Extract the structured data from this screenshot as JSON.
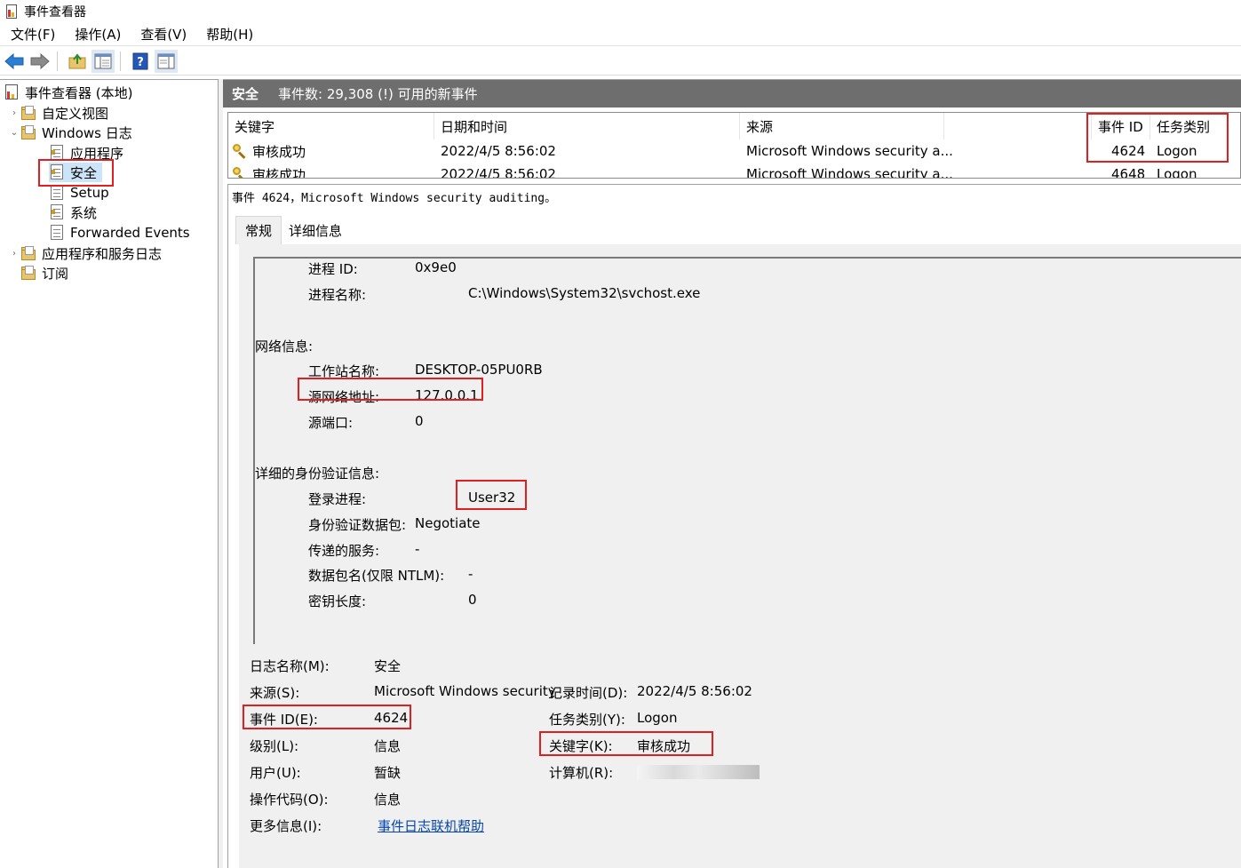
{
  "window": {
    "title": "事件查看器"
  },
  "menu": [
    {
      "label": "文件(F)"
    },
    {
      "label": "操作(A)"
    },
    {
      "label": "查看(V)"
    },
    {
      "label": "帮助(H)"
    }
  ],
  "toolbar": {
    "icons": [
      "back-arrow-icon",
      "forward-arrow-icon",
      "folder-up-icon",
      "show-hide-tree-icon",
      "help-icon",
      "properties-icon"
    ]
  },
  "tree": {
    "root": "事件查看器 (本地)",
    "custom_views": "自定义视图",
    "windows_logs": "Windows 日志",
    "application": "应用程序",
    "security": "安全",
    "setup": "Setup",
    "system": "系统",
    "forwarded": "Forwarded Events",
    "app_service_logs": "应用程序和服务日志",
    "subscriptions": "订阅"
  },
  "header": {
    "name": "安全",
    "count_text": "事件数: 29,308 (!) 可用的新事件"
  },
  "grid": {
    "columns": {
      "keyword": "关键字",
      "datetime": "日期和时间",
      "source": "来源",
      "event_id": "事件 ID",
      "task": "任务类别"
    },
    "rows": [
      {
        "keyword": "审核成功",
        "datetime": "2022/4/5 8:56:02",
        "source": "Microsoft Windows security a...",
        "event_id": "4624",
        "task": "Logon"
      },
      {
        "keyword": "审核成功",
        "datetime": "2022/4/5 8:56:02",
        "source": "Microsoft Windows security a...",
        "event_id": "4648",
        "task": "Logon"
      }
    ]
  },
  "detail": {
    "title": "事件 4624，Microsoft Windows security auditing。",
    "tabs": {
      "general": "常规",
      "details": "详细信息"
    },
    "message": {
      "process_id_label": "进程 ID:",
      "process_id_value": "0x9e0",
      "process_name_label": "进程名称:",
      "process_name_value": "C:\\Windows\\System32\\svchost.exe",
      "network_header": "网络信息:",
      "workstation_label": "工作站名称:",
      "workstation_value": "DESKTOP-05PU0RB",
      "src_addr_label": "源网络地址:",
      "src_addr_value": "127.0.0.1",
      "src_port_label": "源端口:",
      "src_port_value": "0",
      "auth_header": "详细的身份验证信息:",
      "logon_process_label": "登录进程:",
      "logon_process_value": "User32",
      "auth_pkg_label": "身份验证数据包:",
      "auth_pkg_value": "Negotiate",
      "transited_label": "传递的服务:",
      "transited_value": "-",
      "pkg_name_label": "数据包名(仅限 NTLM):",
      "pkg_name_value": "-",
      "key_len_label": "密钥长度:",
      "key_len_value": "0"
    },
    "props": {
      "log_name_label": "日志名称(M):",
      "log_name_value": "安全",
      "source_label": "来源(S):",
      "source_value": "Microsoft Windows security",
      "logged_label": "记录时间(D):",
      "logged_value": "2022/4/5 8:56:02",
      "event_id_label": "事件 ID(E):",
      "event_id_value": "4624",
      "task_label": "任务类别(Y):",
      "task_value": "Logon",
      "level_label": "级别(L):",
      "level_value": "信息",
      "keywords_label": "关键字(K):",
      "keywords_value": "审核成功",
      "user_label": "用户(U):",
      "user_value": "暂缺",
      "computer_label": "计算机(R):",
      "opcode_label": "操作代码(O):",
      "opcode_value": "信息",
      "more_info_label": "更多信息(I):",
      "more_info_link": "事件日志联机帮助"
    }
  },
  "colors": {
    "highlight": "#e02020",
    "header_bg": "#6e6e6e",
    "link": "#0645ad"
  }
}
